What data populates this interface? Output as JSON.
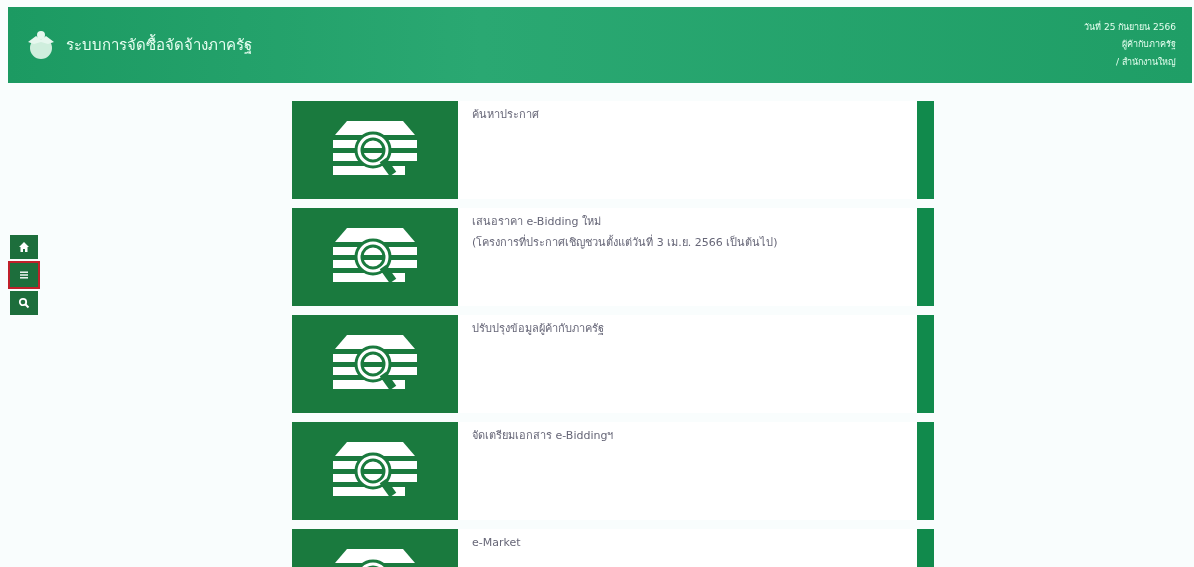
{
  "header": {
    "title": "ระบบการจัดซื้อจัดจ้างภาครัฐ",
    "info_lines": [
      "วันที่ 25 กันยายน 2566",
      "ผู้ค้ากับภาครัฐ",
      "/ สำนักงานใหญ่"
    ]
  },
  "sidebar": {
    "buttons": [
      {
        "kind": "home",
        "highlighted": false
      },
      {
        "kind": "menu",
        "highlighted": true
      },
      {
        "kind": "search",
        "highlighted": false
      }
    ]
  },
  "menu_items": [
    {
      "lines": [
        "ค้นหาประกาศ"
      ]
    },
    {
      "lines": [
        "เสนอราคา e-Bidding ใหม่",
        "(โครงการที่ประกาศเชิญชวนตั้งแต่วันที่ 3 เม.ย. 2566 เป็นต้นไป)"
      ]
    },
    {
      "lines": [
        "ปรับปรุงข้อมูลผู้ค้ากับภาครัฐ"
      ]
    },
    {
      "lines": [
        "จัดเตรียมเอกสาร e-Biddingฯ"
      ]
    },
    {
      "lines": [
        "e-Market"
      ]
    }
  ]
}
